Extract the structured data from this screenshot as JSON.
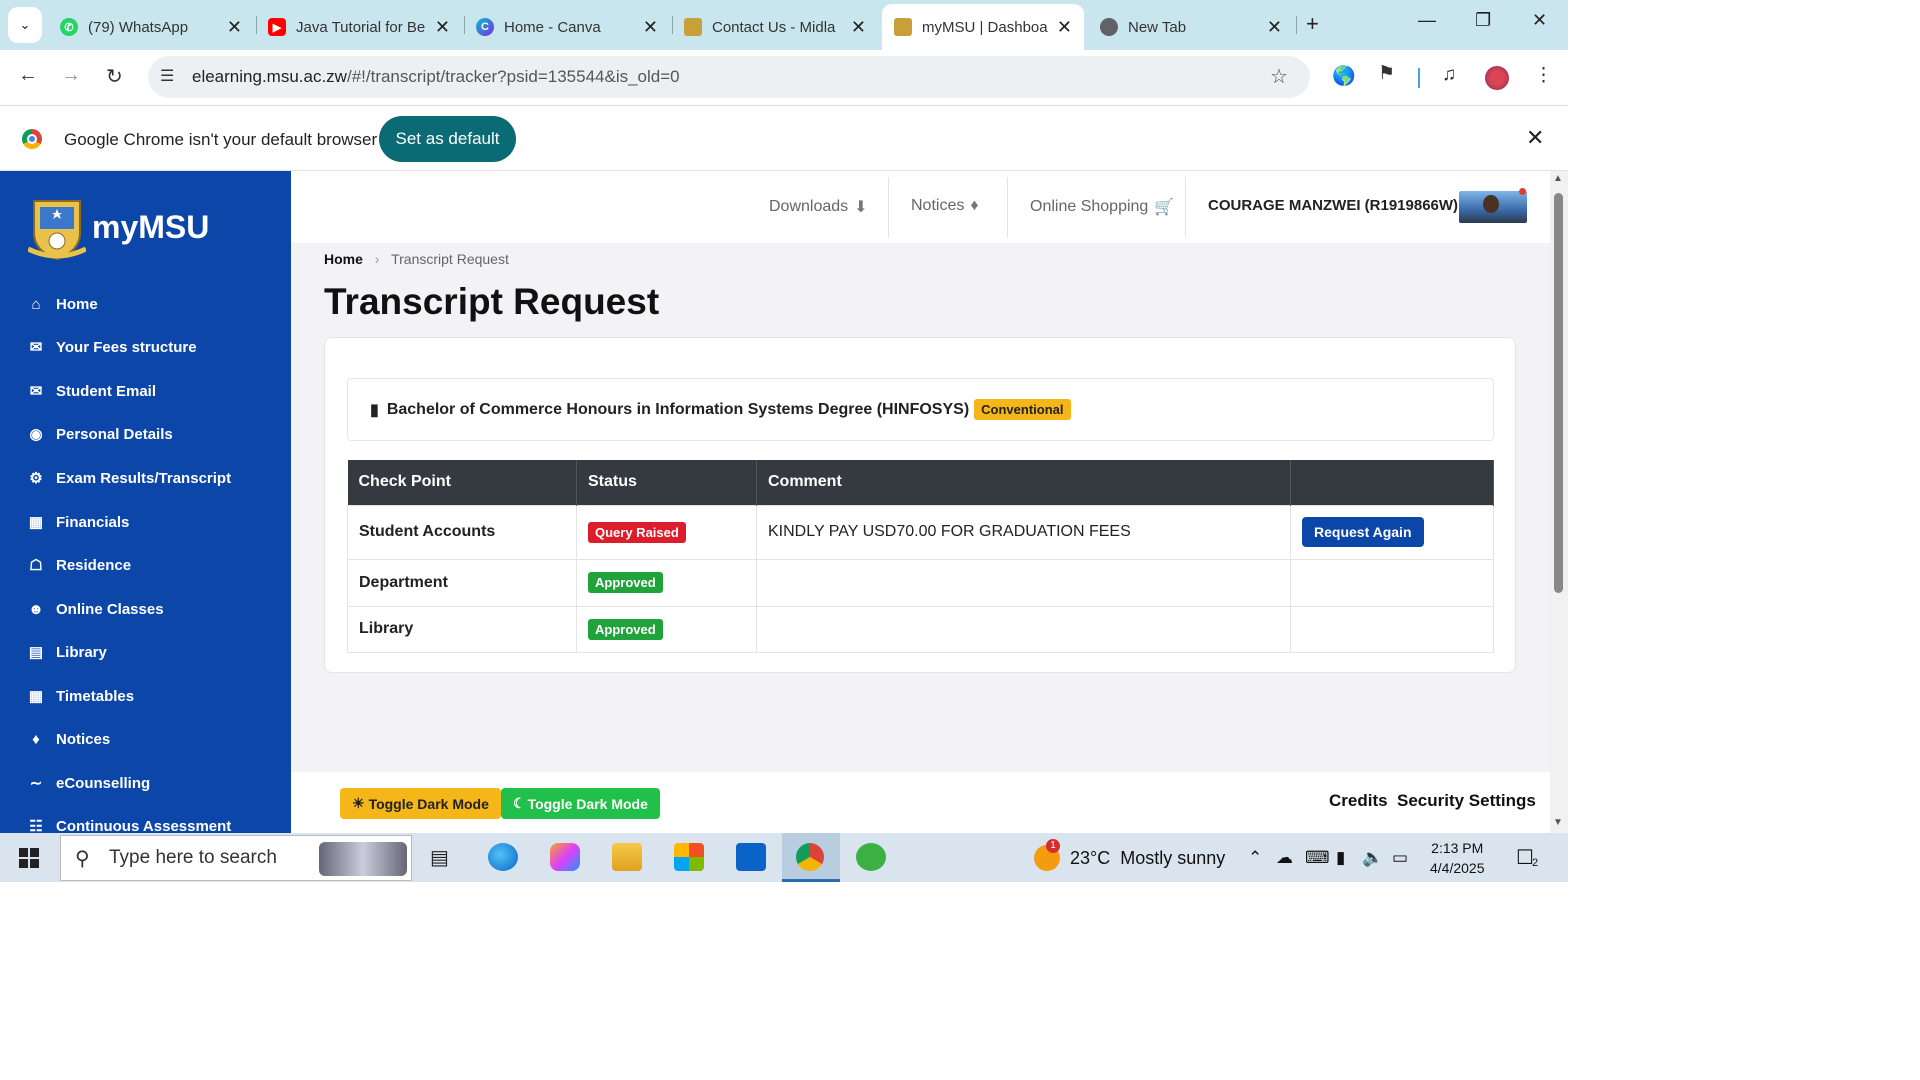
{
  "browser": {
    "tabs": [
      {
        "title": "(79) WhatsApp",
        "icon": "whatsapp-icon",
        "color": "#25d366"
      },
      {
        "title": "Java Tutorial for Be",
        "icon": "youtube-icon",
        "color": "#ff0000"
      },
      {
        "title": "Home - Canva",
        "icon": "canva-icon",
        "color": "#7d2ae8"
      },
      {
        "title": "Contact Us - Midla",
        "icon": "msu-icon",
        "color": "#c8a03a"
      },
      {
        "title": "myMSU | Dashboa",
        "icon": "msu-icon",
        "color": "#c8a03a"
      },
      {
        "title": "New Tab",
        "icon": "chrome-icon",
        "color": "#5f6368"
      }
    ],
    "url_host": "elearning.msu.ac.zw",
    "url_path": "/#!/transcript/tracker?psid=135544&is_old=0"
  },
  "infobar": {
    "message": "Google Chrome isn't your default browser",
    "button": "Set as default"
  },
  "sidebar": {
    "brand": "myMSU",
    "items": [
      {
        "label": "Home",
        "icon": "home-icon"
      },
      {
        "label": "Your Fees structure",
        "icon": "envelope-icon"
      },
      {
        "label": "Student Email",
        "icon": "envelope-icon"
      },
      {
        "label": "Personal Details",
        "icon": "user-circle-icon"
      },
      {
        "label": "Exam Results/Transcript",
        "icon": "cog-icon"
      },
      {
        "label": "Financials",
        "icon": "money-icon"
      },
      {
        "label": "Residence",
        "icon": "warehouse-icon"
      },
      {
        "label": "Online Classes",
        "icon": "users-icon"
      },
      {
        "label": "Library",
        "icon": "book-icon"
      },
      {
        "label": "Timetables",
        "icon": "table-icon"
      },
      {
        "label": "Notices",
        "icon": "bell-icon"
      },
      {
        "label": "eCounselling",
        "icon": "handshake-icon"
      },
      {
        "label": "Continuous Assessment",
        "icon": "sitemap-icon"
      }
    ]
  },
  "topbar": {
    "downloads": "Downloads",
    "notices": "Notices",
    "shopping": "Online Shopping",
    "user": "COURAGE MANZWEI (R1919866W)"
  },
  "breadcrumb": {
    "home": "Home",
    "current": "Transcript Request"
  },
  "page": {
    "title": "Transcript Request",
    "programme": "Bachelor of Commerce Honours in Information Systems Degree (HINFOSYS)",
    "programme_badge": "Conventional"
  },
  "table": {
    "headers": [
      "Check Point",
      "Status",
      "Comment",
      ""
    ],
    "rows": [
      {
        "checkpoint": "Student Accounts",
        "status": "Query Raised",
        "comment": "KINDLY PAY USD70.00 FOR GRADUATION FEES",
        "action": "Request Again"
      },
      {
        "checkpoint": "Department",
        "status": "Approved",
        "comment": "",
        "action": ""
      },
      {
        "checkpoint": "Library",
        "status": "Approved",
        "comment": "",
        "action": ""
      }
    ]
  },
  "footer": {
    "toggle_light": "Toggle Dark Mode",
    "toggle_dark": "Toggle Dark Mode",
    "credits": "Credits",
    "security": "Security Settings"
  },
  "taskbar": {
    "search_placeholder": "Type here to search",
    "weather_temp": "23°C",
    "weather_desc": "Mostly sunny",
    "time": "2:13 PM",
    "date": "4/4/2025",
    "notifications": "2",
    "weather_badge": "1"
  }
}
